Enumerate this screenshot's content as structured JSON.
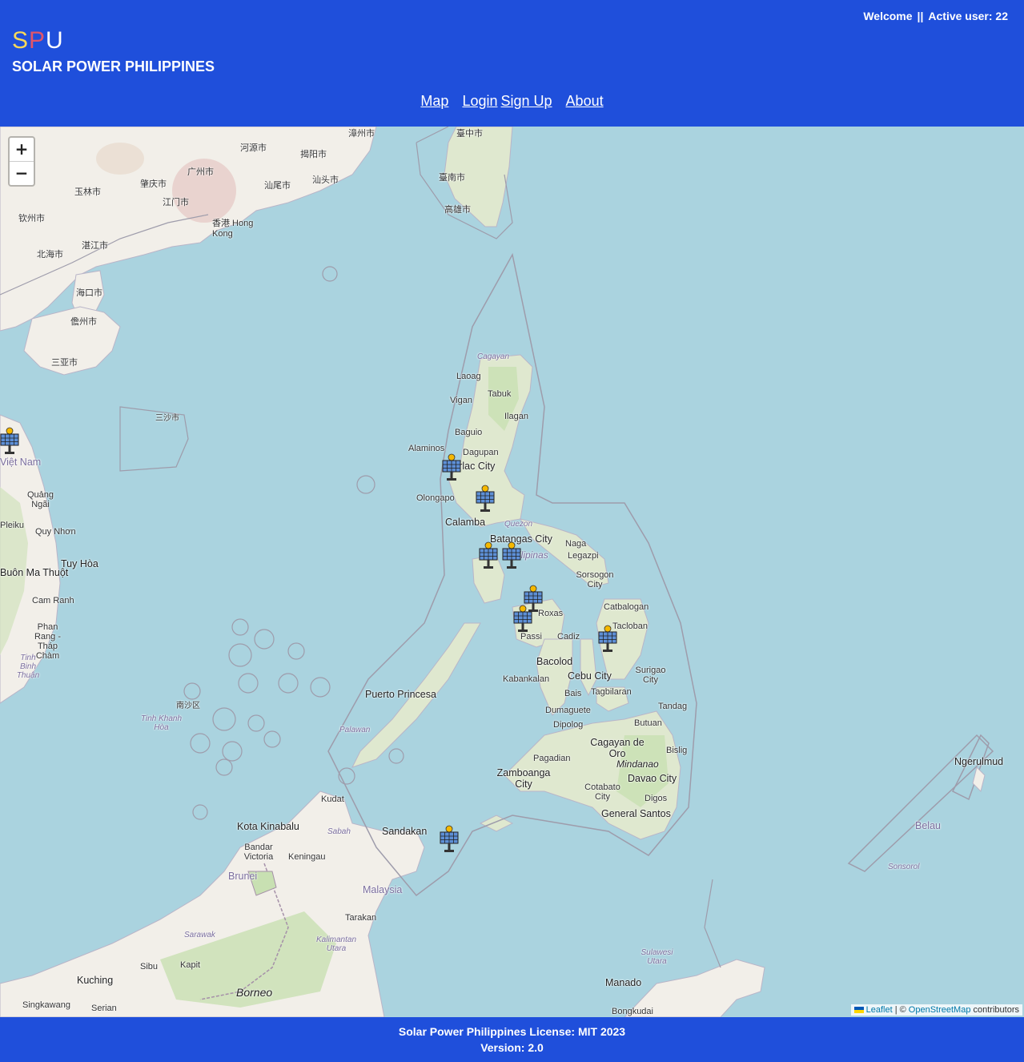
{
  "header": {
    "welcome": "Welcome",
    "separator": "||",
    "active_user": "Active user: 22",
    "logo": {
      "s": "S",
      "p": "P",
      "u": "U"
    },
    "brand_title": "SOLAR POWER PHILIPPINES",
    "nav": {
      "map": "Map",
      "login": "Login",
      "signup": "Sign Up",
      "about": "About"
    }
  },
  "map": {
    "zoom_in": "+",
    "zoom_out": "−",
    "attribution": {
      "leaflet": "Leaflet",
      "sep": "| ©",
      "osm": "OpenStreetMap",
      "contributors": "contributors"
    },
    "places": [
      "河源市",
      "揭阳市",
      "汕头市",
      "汕尾市",
      "广州市",
      "肇庆市",
      "江门市",
      "香港 Hong Kong",
      "玉林市",
      "钦州市",
      "湛江市",
      "北海市",
      "海口市",
      "儋州市",
      "三亚市",
      "三沙市",
      "臺南市",
      "高雄市",
      "漳州市",
      "臺中市",
      "Cagayan",
      "Laoag",
      "Tabuk",
      "Vigan",
      "Ilagan",
      "Baguio",
      "Alaminos",
      "Dagupan",
      "Tarlac City",
      "Olongapo",
      "Calamba",
      "Batangas City",
      "Naga",
      "Legazpi",
      "Sorsogon City",
      "Catbalogan",
      "Tacloban",
      "Roxas",
      "Passi",
      "Cadiz",
      "Bacolod",
      "Kabankalan",
      "Cebu City",
      "Bais",
      "Tagbilaran",
      "Dumaguete",
      "Surigao City",
      "Tandag",
      "Butuan",
      "Dipolog",
      "Pagadian",
      "Cagayan de Oro",
      "Bislig",
      "Zamboanga City",
      "Cotabato City",
      "Davao City",
      "Digos",
      "General Santos",
      "Puerto Princesa",
      "Palawan",
      "Kota Kinabalu",
      "Kudat",
      "Sandakan",
      "Bandar Victoria",
      "Keningau",
      "Brunei",
      "Malaysia",
      "Tarakan",
      "Sarawak",
      "Kapit",
      "Sibu",
      "Kuching",
      "Serian",
      "Singkawang",
      "Borneo",
      "Manado",
      "Bongkudai",
      "Ngerulmud",
      "Belau",
      "Sonsorol",
      "Việt Nam",
      "Quảng Ngãi",
      "Pleiku",
      "Quy Nhơn",
      "Tuy Hòa",
      "Buôn Ma Thuột",
      "Cam Ranh",
      "Phan Rang - Tháp Chàm",
      "Tinh Binh Thuận",
      "Tinh Khanh Hòa",
      "南沙区",
      "Mindanao",
      "Kalimantan Utara",
      "Sulawesi Utara",
      "Sabah",
      "Quezon",
      "Pilipinas"
    ],
    "markers": [
      "solar-marker",
      "solar-marker",
      "solar-marker",
      "solar-marker",
      "solar-marker",
      "solar-marker",
      "solar-marker",
      "solar-marker",
      "solar-marker",
      "solar-marker"
    ]
  },
  "footer": {
    "license": "Solar Power Philippines License: MIT 2023",
    "version": "Version: 2.0"
  },
  "colors": {
    "header_bg": "#1f4fdb",
    "water": "#aad3df",
    "land": "#f2efe9",
    "forest": "#c8e0b2",
    "border": "#9e9cab"
  }
}
